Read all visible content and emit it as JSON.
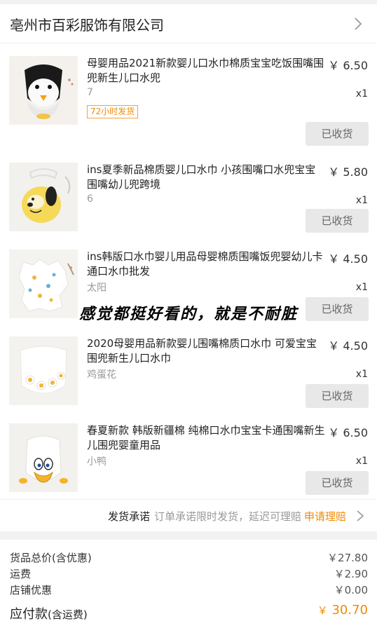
{
  "shop": {
    "name": "亳州市百彩服饰有限公司"
  },
  "items": [
    {
      "title": "母婴用品2021新款婴儿口水巾棉质宝宝吃饭围嘴围兜新生儿口水兜",
      "price": "￥ 6.50",
      "spec": "7",
      "qty": "x1",
      "badge": "72小时发货",
      "status": "已收货"
    },
    {
      "title": "ins夏季新品棉质婴儿口水巾 小孩围嘴口水兜宝宝围嘴幼儿兜跨境",
      "price": "￥ 5.80",
      "spec": "6",
      "qty": "x1",
      "status": "已收货"
    },
    {
      "title": "ins韩版口水巾婴儿用品母婴棉质围嘴饭兜婴幼儿卡通口水巾批发",
      "price": "￥ 4.50",
      "spec": "太阳",
      "qty": "x1",
      "status": "已收货"
    },
    {
      "title": "2020母婴用品新款婴儿围嘴棉质口水巾 可爱宝宝围兜新生儿口水巾",
      "price": "￥ 4.50",
      "spec": "鸡蛋花",
      "qty": "x1",
      "status": "已收货"
    },
    {
      "title": "春夏新款 韩版新疆棉 纯棉口水巾宝宝卡通围嘴新生儿围兜婴童用品",
      "price": "￥ 6.50",
      "spec": "小鸭",
      "qty": "x1",
      "status": "已收货"
    }
  ],
  "overlay": {
    "caption": "感觉都挺好看的，就是不耐脏"
  },
  "promise": {
    "label": "发货承诺",
    "desc": "订单承诺限时发货，延迟可理赔",
    "link": "申请理赔"
  },
  "summary": {
    "goods_total_label": "货品总价(含优惠)",
    "goods_total": "￥27.80",
    "shipping_label": "运费",
    "shipping": "￥2.90",
    "discount_label": "店铺优惠",
    "discount": "￥0.00",
    "payable_label": "应付款",
    "payable_note": "(含运费)",
    "payable_currency": "￥",
    "payable": "30.70"
  },
  "colors": {
    "accent": "#f38a00",
    "button_bg": "#e8e8e8"
  }
}
